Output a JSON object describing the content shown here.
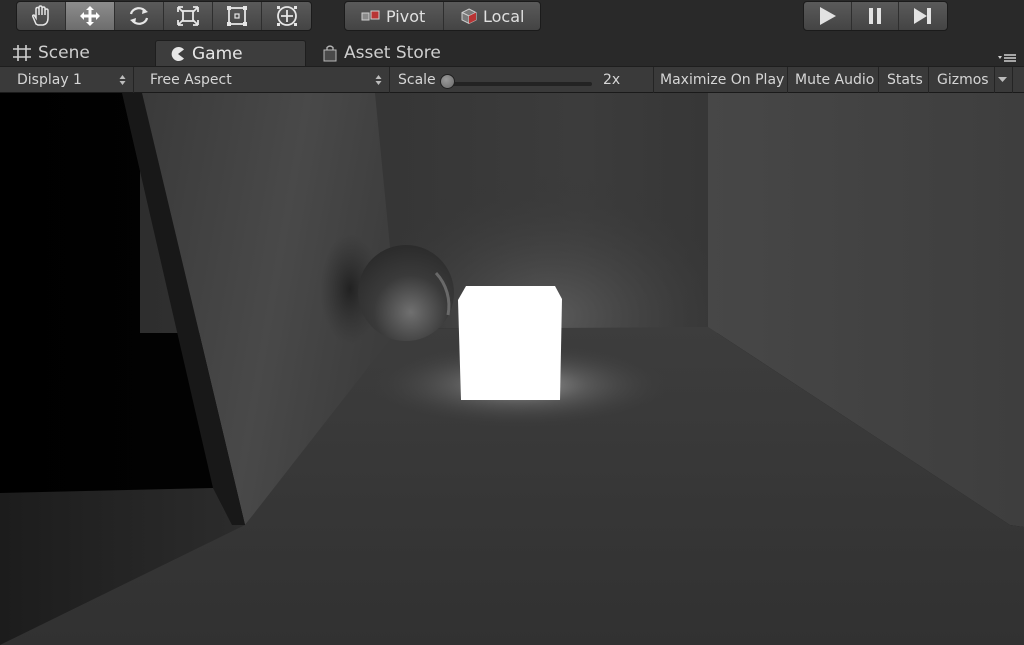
{
  "toolbar": {
    "transform_tools": [
      "hand-tool",
      "move-tool",
      "rotate-tool",
      "scale-tool",
      "rect-tool",
      "transform-tool"
    ],
    "active_tool": "move-tool",
    "pivot_label": "Pivot",
    "local_label": "Local",
    "playback": [
      "play",
      "pause",
      "step"
    ]
  },
  "tabs": {
    "scene": "Scene",
    "game": "Game",
    "asset_store": "Asset Store",
    "active": "Game"
  },
  "game_bar": {
    "display": "Display 1",
    "aspect": "Free Aspect",
    "scale_label": "Scale",
    "scale_value": "2x",
    "maximize": "Maximize On Play",
    "mute": "Mute Audio",
    "stats": "Stats",
    "gizmos": "Gizmos"
  },
  "colors": {
    "toolbar_bg": "#292929",
    "control_bar_bg": "#3a3a3a",
    "active_button": "#7d7d7d",
    "emissive_cube": "#ffffff"
  }
}
